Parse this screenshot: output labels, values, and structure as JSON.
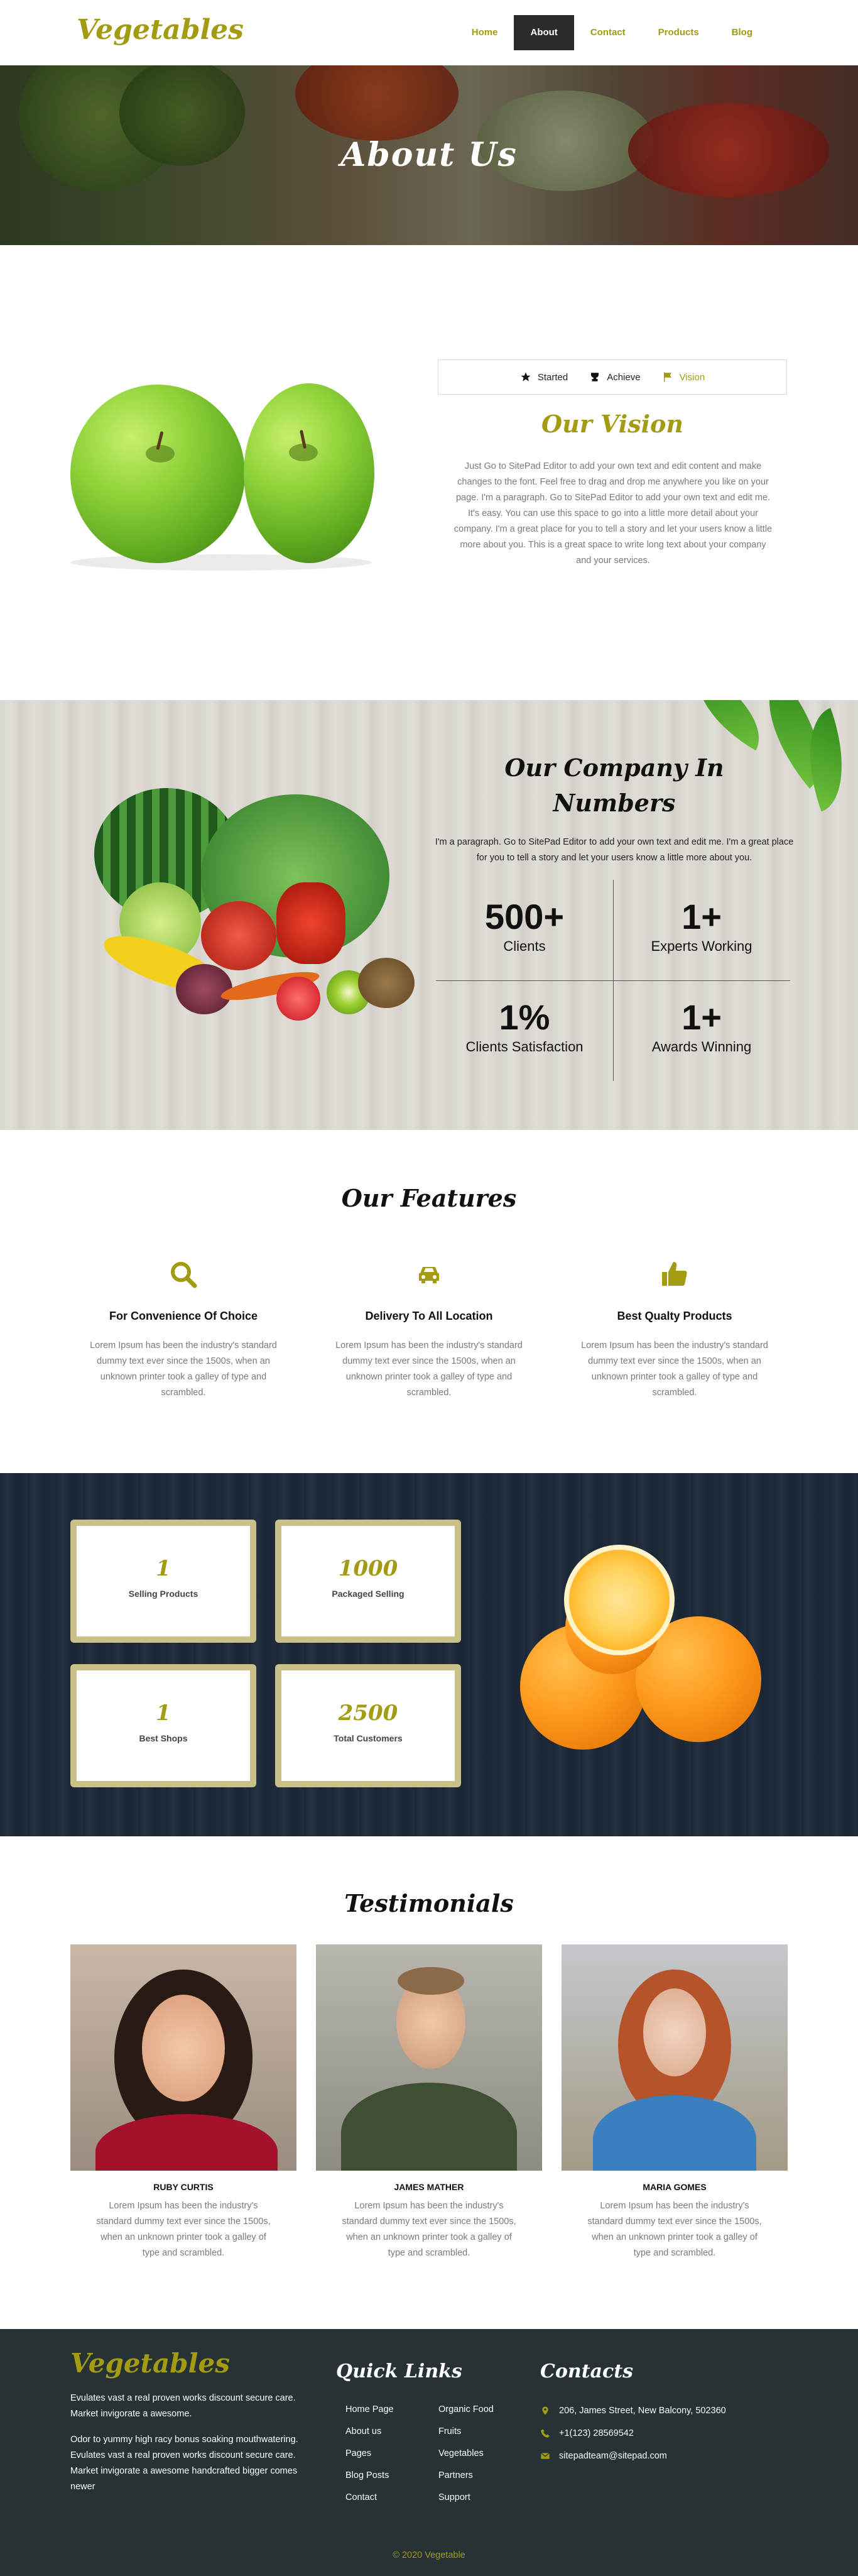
{
  "brand": {
    "logo": "Vegetables",
    "accent": "#a39b12",
    "dark": "#2b2b2b"
  },
  "nav": {
    "items": [
      {
        "label": "Home"
      },
      {
        "label": "About"
      },
      {
        "label": "Contact"
      },
      {
        "label": "Products"
      },
      {
        "label": "Blog"
      }
    ],
    "active": "About"
  },
  "hero": {
    "title": "About Us"
  },
  "vision": {
    "tabs": [
      {
        "label": "Started",
        "icon": "star-icon"
      },
      {
        "label": "Achieve",
        "icon": "trophy-icon"
      },
      {
        "label": "Vision",
        "icon": "flag-icon"
      }
    ],
    "title": "Our Vision",
    "text": "Just Go to SitePad Editor to add your own text and edit content and make changes to the font. Feel free to drag and drop me anywhere you like on your page. I'm a paragraph. Go to SitePad Editor to add your own text and edit me. It's easy. You can use this space to go into a little more detail about your company. I'm a great place for you to tell a story and let your users know a little more about you. This is a great space to write long text about your company and your services."
  },
  "numbers": {
    "title_line1": "Our Company In",
    "title_line2": "Numbers",
    "subtitle": "I'm a paragraph. Go to SitePad Editor to add your own text and edit me. I'm a great place for you to tell a story and let your users know a little more about you.",
    "stats": [
      {
        "value": "500+",
        "label": "Clients"
      },
      {
        "value": "1+",
        "label": "Experts Working"
      },
      {
        "value": "1%",
        "label": "Clients Satisfaction"
      },
      {
        "value": "1+",
        "label": "Awards Winning"
      }
    ]
  },
  "features": {
    "title": "Our Features",
    "items": [
      {
        "icon": "search-icon",
        "title": "For Convenience Of Choice",
        "text": "Lorem Ipsum has been the industry's standard dummy text ever since the 1500s, when an unknown printer took a galley of type and scrambled."
      },
      {
        "icon": "car-icon",
        "title": "Delivery To All Location",
        "text": "Lorem Ipsum has been the industry's standard dummy text ever since the 1500s, when an unknown printer took a galley of type and scrambled."
      },
      {
        "icon": "thumbs-up-icon",
        "title": "Best Qualty Products",
        "text": "Lorem Ipsum has been the industry's standard dummy text ever since the 1500s, when an unknown printer took a galley of type and scrambled."
      }
    ]
  },
  "counters": [
    {
      "value": "1",
      "label": "Selling Products"
    },
    {
      "value": "1000",
      "label": "Packaged Selling"
    },
    {
      "value": "1",
      "label": "Best Shops"
    },
    {
      "value": "2500",
      "label": "Total Customers"
    }
  ],
  "testimonials": {
    "title": "Testimonials",
    "people": [
      {
        "name": "RUBY CURTIS",
        "text": "Lorem Ipsum has been the industry's standard dummy text ever since the 1500s, when an unknown printer took a galley of type and scrambled."
      },
      {
        "name": "JAMES MATHER",
        "text": "Lorem Ipsum has been the industry's standard dummy text ever since the 1500s, when an unknown printer took a galley of type and scrambled."
      },
      {
        "name": "MARIA GOMES",
        "text": "Lorem Ipsum has been the industry's standard dummy text ever since the 1500s, when an unknown printer took a galley of type and scrambled."
      }
    ]
  },
  "footer": {
    "logo": "Vegetables",
    "about_1": "Evulates vast a real proven works discount secure care. Market invigorate a awesome.",
    "about_2": "Odor to yummy high racy bonus soaking mouthwatering. Evulates vast a real proven works discount secure care. Market invigorate a awesome handcrafted bigger comes newer",
    "quick_links_title": "Quick Links",
    "links_col1": [
      "Home Page",
      "About us",
      "Pages",
      "Blog Posts",
      "Contact"
    ],
    "links_col2": [
      "Organic Food",
      "Fruits",
      "Vegetables",
      "Partners",
      "Support"
    ],
    "contacts_title": "Contacts",
    "address": "206, James Street, New Balcony, 502360",
    "phone": "+1(123) 28569542",
    "email": "sitepadteam@sitepad.com",
    "copyright": "© 2020 Vegetable"
  }
}
